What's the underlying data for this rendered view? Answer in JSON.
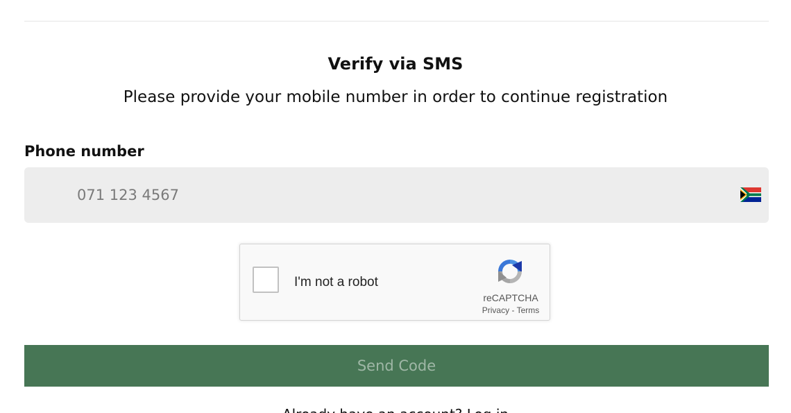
{
  "header": {
    "title": "Verify via SMS",
    "subtitle": "Please provide your mobile number in order to continue registration"
  },
  "phone": {
    "label": "Phone number",
    "placeholder": "071 123 4567",
    "value": "",
    "country_flag_icon": "south-africa-flag-icon"
  },
  "recaptcha": {
    "checkbox_label": "I'm not a robot",
    "brand": "reCAPTCHA",
    "privacy": "Privacy",
    "separator": "-",
    "terms": "Terms",
    "logo_icon": "recaptcha-logo-icon"
  },
  "actions": {
    "send_code_label": "Send Code"
  },
  "footer": {
    "text": "Already have an account? Log in"
  },
  "colors": {
    "button_bg": "#477655",
    "button_text": "#9fb7a6",
    "field_bg": "#ededed"
  }
}
